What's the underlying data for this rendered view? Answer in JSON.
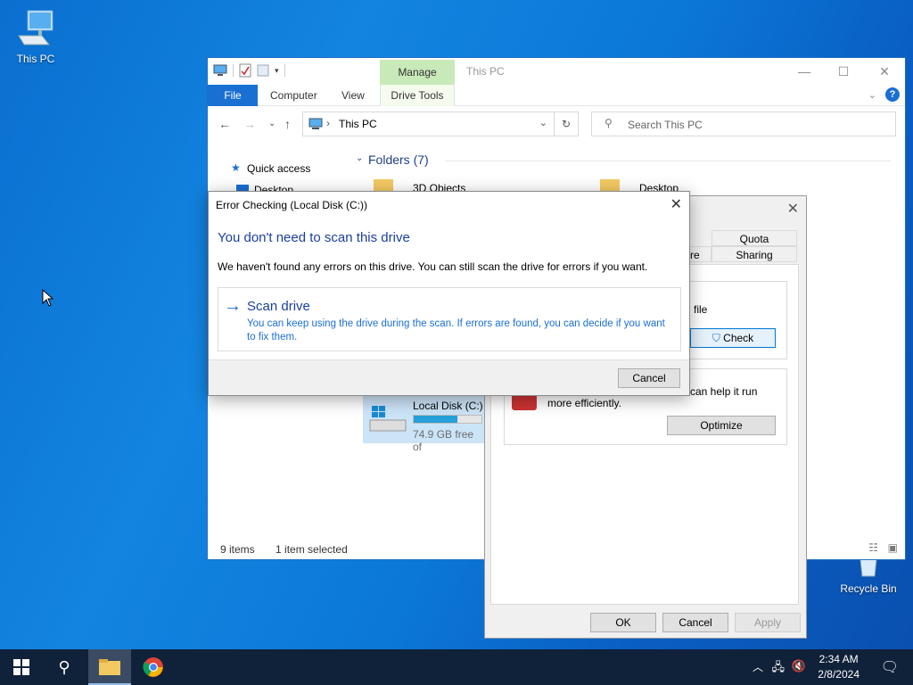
{
  "desktop": {
    "icons": [
      {
        "label": "This PC",
        "icon": "this-pc-icon"
      },
      {
        "label": "Recycle Bin",
        "icon": "recycle-bin-icon"
      }
    ]
  },
  "explorer": {
    "title": "This PC",
    "ribbon": {
      "manage_label": "Manage",
      "tabs": [
        "File",
        "Computer",
        "View",
        "Drive Tools"
      ]
    },
    "address": {
      "crumb": "This PC"
    },
    "search": {
      "placeholder": "Search This PC"
    },
    "nav": {
      "quick_access": "Quick access",
      "desktop": "Desktop"
    },
    "folders_header": "Folders (7)",
    "folders": [
      "3D Objects",
      "Desktop"
    ],
    "drive": {
      "name": "Local Disk (C:)",
      "free": "74.9 GB free of",
      "used_fraction": 0.65
    },
    "status": {
      "items": "9 items",
      "selected": "1 item selected"
    }
  },
  "properties": {
    "tabs": [
      "Quota",
      "Sharing",
      "are"
    ],
    "error_fragment": "file",
    "check_button": "Check",
    "optimize_text": "can help it run",
    "optimize_text2": "more efficiently.",
    "optimize_button": "Optimize",
    "ok": "OK",
    "cancel": "Cancel",
    "apply": "Apply"
  },
  "error_dialog": {
    "title": "Error Checking (Local Disk (C:))",
    "heading": "You don't need to scan this drive",
    "message": "We haven't found any errors on this drive. You can still scan the drive for errors if you want.",
    "scan_title": "Scan drive",
    "scan_desc": "You can keep using the drive during the scan. If errors are found, you can decide if you want to fix them.",
    "cancel": "Cancel"
  },
  "taskbar": {
    "time": "2:34 AM",
    "date": "2/8/2024"
  },
  "colors": {
    "accent": "#1a6fd3",
    "heading_blue": "#1a3fa0",
    "taskbar": "#10213a"
  }
}
